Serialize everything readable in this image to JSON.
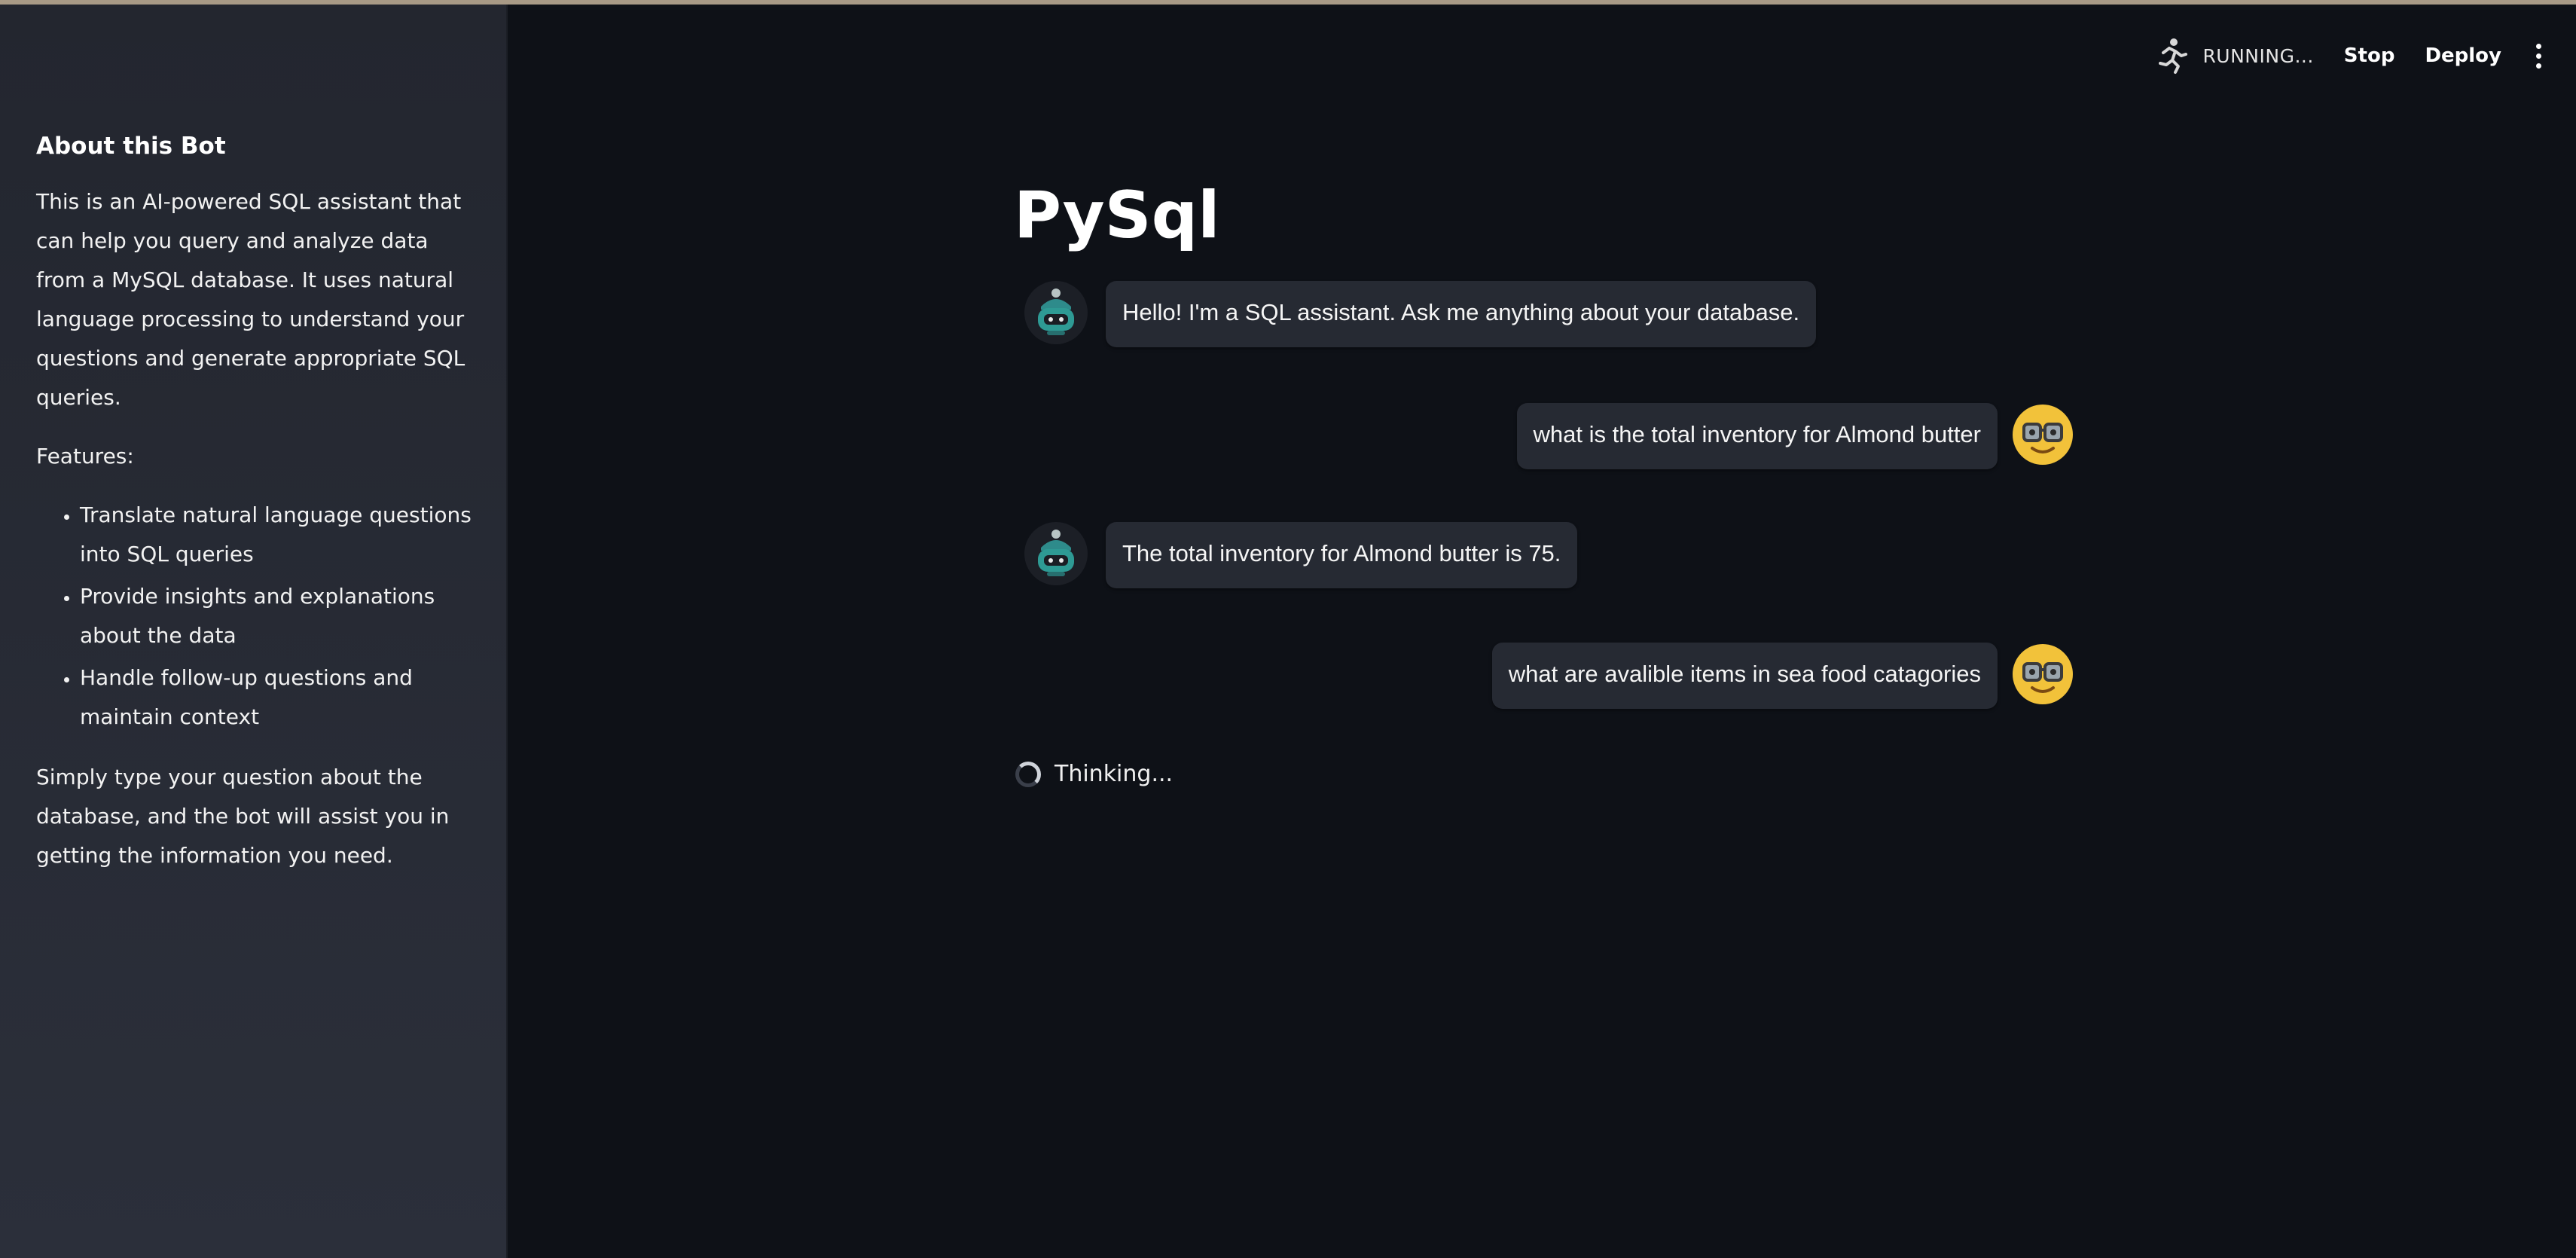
{
  "app": {
    "title": "PySql"
  },
  "header": {
    "status": "RUNNING...",
    "stop_label": "Stop",
    "deploy_label": "Deploy",
    "running_icon": "running-man-icon",
    "menu_icon": "vertical-dots-icon"
  },
  "sidebar": {
    "title": "About this Bot",
    "intro": "This is an AI-powered SQL assistant that can help you query and analyze data from a MySQL database. It uses natural language processing to understand your questions and generate appropriate SQL queries.",
    "features_label": "Features:",
    "features": [
      "Translate natural language questions into SQL queries",
      "Provide insights and explanations about the data",
      "Handle follow-up questions and maintain context"
    ],
    "outro": "Simply type your question about the database, and the bot will assist you in getting the information you need."
  },
  "chat": {
    "messages": [
      {
        "role": "assistant",
        "text": "Hello! I'm a SQL assistant. Ask me anything about your database."
      },
      {
        "role": "user",
        "text": "what is the total inventory for Almond butter"
      },
      {
        "role": "assistant",
        "text": "The total inventory for Almond butter is 75."
      },
      {
        "role": "user",
        "text": "what are avalible items in sea food catagories"
      }
    ],
    "status": "Thinking..."
  },
  "colors": {
    "background": "#0e1117",
    "sidebar": "#262a33",
    "bubble": "#262a33",
    "bot_avatar": "#2e8b8b",
    "user_avatar": "#f2c23a"
  }
}
